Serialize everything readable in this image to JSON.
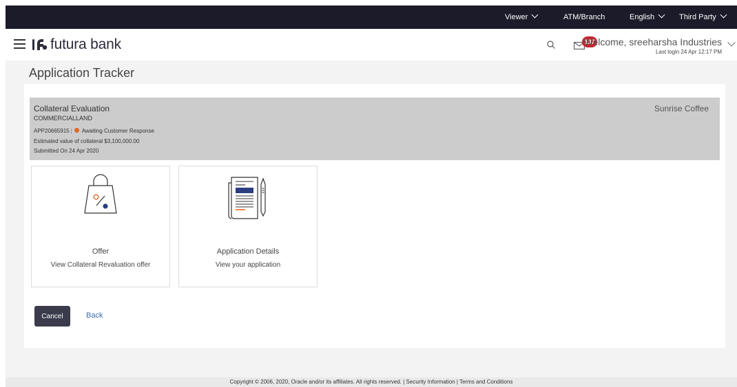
{
  "topbar": {
    "items": [
      {
        "label": "Viewer",
        "has_chevron": true
      },
      {
        "label": "ATM/Branch",
        "has_chevron": false
      },
      {
        "label": "English",
        "has_chevron": true
      },
      {
        "label": "Third Party",
        "has_chevron": true
      }
    ]
  },
  "header": {
    "brand": "futura bank",
    "notification_count": "137",
    "welcome": "Welcome, sreeharsha Industries",
    "last_login": "Last login 24 Apr 12:17 PM"
  },
  "page": {
    "title": "Application Tracker"
  },
  "summary": {
    "title": "Collateral Evaluation",
    "type": "COMMERCIALLAND",
    "app_id": "APP20665915",
    "status": "Awaiting Customer Response",
    "status_color": "#e0682a",
    "estimated_value": "Estimated value of collateral $3,100,000.00",
    "submitted": "Submitted On 24 Apr 2020",
    "company": "Sunrise Coffee"
  },
  "tiles": [
    {
      "title": "Offer",
      "desc": "View Collateral Revaluation offer",
      "icon": "offer-bag-icon"
    },
    {
      "title": "Application Details",
      "desc": "View your application",
      "icon": "document-pen-icon"
    }
  ],
  "actions": {
    "cancel": "Cancel",
    "back": "Back"
  },
  "footer": {
    "text": "Copyright © 2006, 2020, Oracle and/or its affiliates. All rights reserved. | Security Information | Terms and Conditions"
  },
  "colors": {
    "topbar": "#1b1b2a",
    "badge": "#c4262e",
    "primary_button": "#3a3c4c",
    "link": "#3d6bb3",
    "accent_blue": "#2c3e80",
    "accent_orange": "#e0682a"
  }
}
